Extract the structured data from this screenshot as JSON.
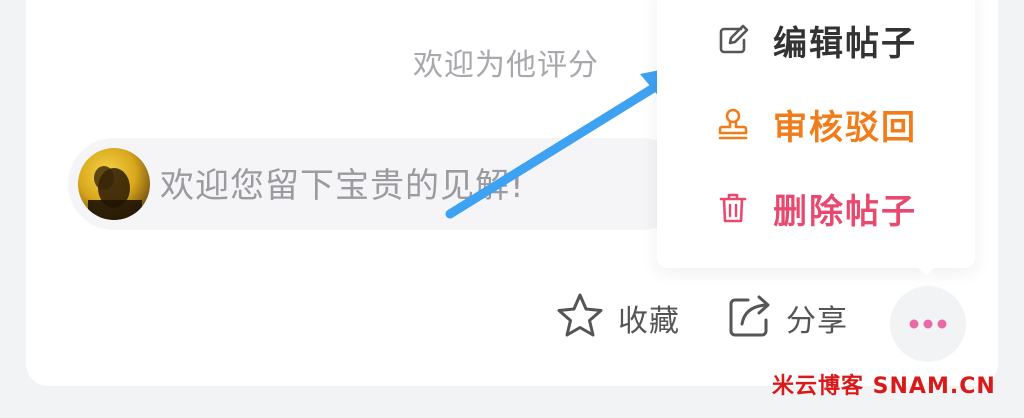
{
  "rating_hint": "欢迎为他评分",
  "comment": {
    "placeholder": "欢迎您留下宝贵的见解!",
    "avatar_icon": "user-avatar"
  },
  "menu": {
    "items": [
      {
        "label": "编辑帖子",
        "icon": "edit-icon",
        "color": "#333333"
      },
      {
        "label": "审核驳回",
        "icon": "stamp-icon",
        "color": "#f07c1a"
      },
      {
        "label": "删除帖子",
        "icon": "trash-icon",
        "color": "#e84a6f"
      }
    ]
  },
  "actions": {
    "favorite_label": "收藏",
    "share_label": "分享",
    "more_icon": "more-dots-icon"
  },
  "colors": {
    "accent_arrow": "#3ea2f2",
    "more_dots": "#e86aa6",
    "watermark": "#d91a1a"
  },
  "watermark": "米云博客 SNAM.CN"
}
